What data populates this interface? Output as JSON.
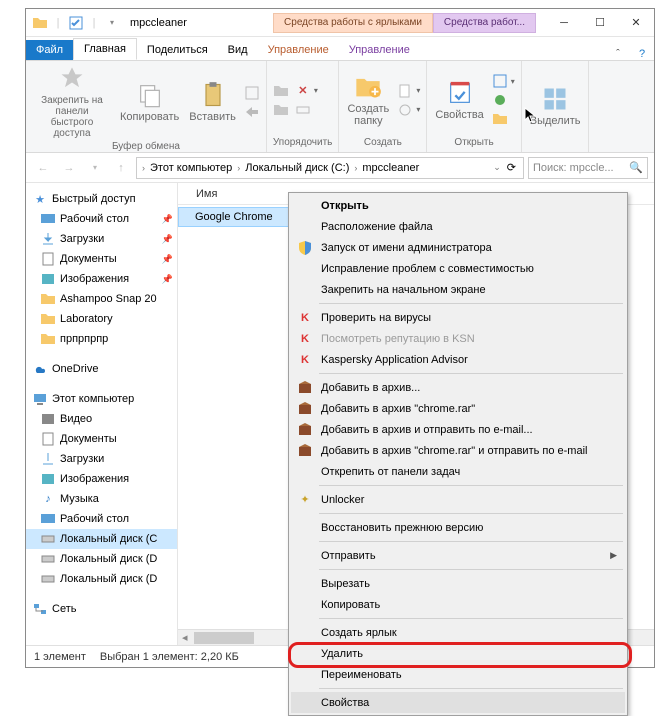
{
  "title": "mpccleaner",
  "titleTabs": {
    "t1": "Средства работы с ярлыками",
    "t2": "Средства работ..."
  },
  "ribbonTabs": {
    "file": "Файл",
    "home": "Главная",
    "share": "Поделиться",
    "view": "Вид",
    "manage1": "Управление",
    "manage2": "Управление"
  },
  "ribbon": {
    "pin": "Закрепить на панели быстрого доступа",
    "copy": "Копировать",
    "paste": "Вставить",
    "clipboard": "Буфер обмена",
    "organize": "Упорядочить",
    "newFolder": "Создать папку",
    "new": "Создать",
    "props": "Свойства",
    "open": "Открыть",
    "select": "Выделить"
  },
  "addr": {
    "pc": "Этот компьютер",
    "drive": "Локальный диск (C:)",
    "folder": "mpccleaner"
  },
  "search": "Поиск: mpccle...",
  "colName": "Имя",
  "file": "Google Chrome",
  "sidebar": {
    "quick": "Быстрый доступ",
    "items": [
      "Рабочий стол",
      "Загрузки",
      "Документы",
      "Изображения",
      "Ashampoo Snap 20",
      "Laboratory",
      "прпрпрпр"
    ],
    "onedrive": "OneDrive",
    "pc": "Этот компьютер",
    "pcItems": [
      "Видео",
      "Документы",
      "Загрузки",
      "Изображения",
      "Музыка",
      "Рабочий стол",
      "Локальный диск (C",
      "Локальный диск (D",
      "Локальный диск (D"
    ],
    "net": "Сеть"
  },
  "ctx": {
    "open": "Открыть",
    "loc": "Расположение файла",
    "admin": "Запуск от имени администратора",
    "compat": "Исправление проблем с совместимостью",
    "pinstart": "Закрепить на начальном экране",
    "virus": "Проверить на вирусы",
    "ksn": "Посмотреть репутацию в KSN",
    "kav": "Kaspersky Application Advisor",
    "arch": "Добавить в архив...",
    "archc": "Добавить в архив \"chrome.rar\"",
    "archm": "Добавить в архив и отправить по e-mail...",
    "archcm": "Добавить в архив \"chrome.rar\" и отправить по e-mail",
    "unpin": "Открепить от панели задач",
    "unlock": "Unlocker",
    "restore": "Восстановить прежнюю версию",
    "send": "Отправить",
    "cut": "Вырезать",
    "copy": "Копировать",
    "shortcut": "Создать ярлык",
    "delete": "Удалить",
    "rename": "Переименовать",
    "props": "Свойства"
  },
  "status": {
    "count": "1 элемент",
    "sel": "Выбран 1 элемент: 2,20 КБ"
  }
}
